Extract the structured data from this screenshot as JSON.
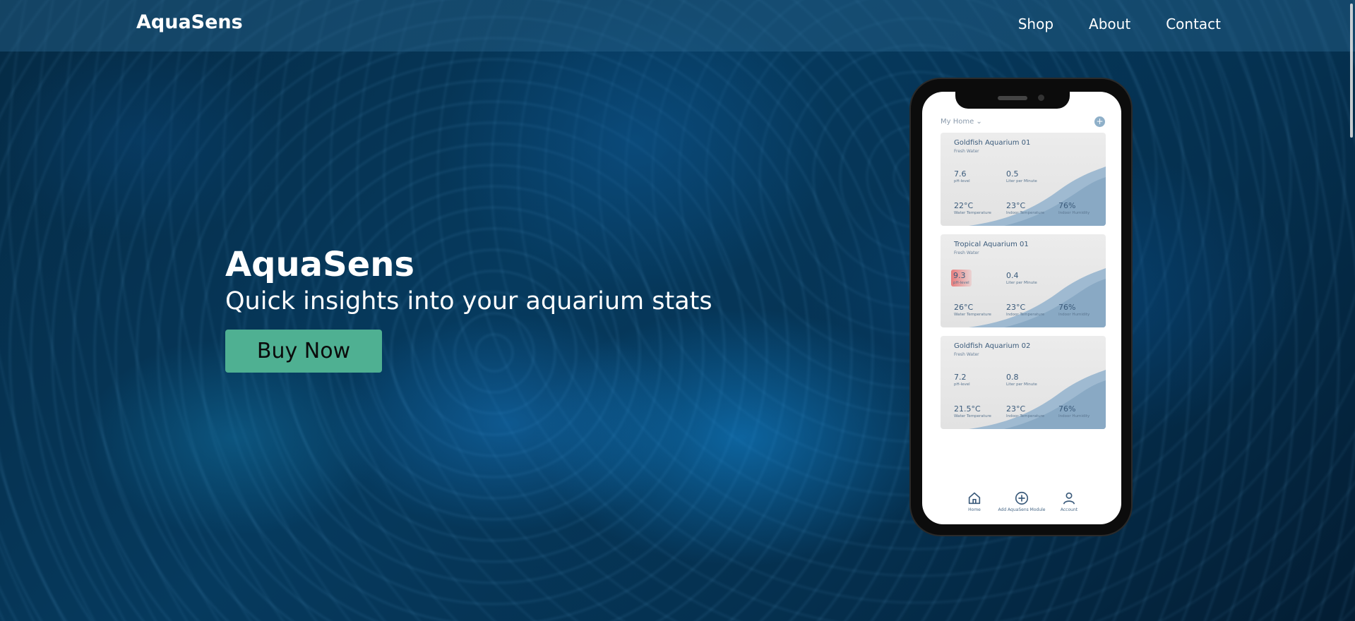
{
  "navbar": {
    "brand": "AquaSens",
    "links": [
      {
        "label": "Shop"
      },
      {
        "label": "About"
      },
      {
        "label": "Contact"
      }
    ]
  },
  "hero": {
    "title": "AquaSens",
    "subtitle": "Quick insights into your aquarium stats",
    "button_label": "Buy Now"
  },
  "phone": {
    "home_selector": "My Home ⌄",
    "add_glyph": "+",
    "cards": [
      {
        "name": "Goldfish Aquarium 01",
        "type": "Fresh Water",
        "ph": "7.6",
        "ph_label": "pH-level",
        "flow": "0.5",
        "flow_label": "Liter per Minute",
        "water_temp": "22°C",
        "water_temp_label": "Water Temperature",
        "indoor_temp": "23°C",
        "indoor_temp_label": "Indoor Temperature",
        "humidity": "76%",
        "humidity_label": "Indoor Humidity"
      },
      {
        "name": "Tropical Aquarium 01",
        "type": "Fresh Water",
        "ph": "9.3",
        "ph_label": "pH-level",
        "flow": "0.4",
        "flow_label": "Liter per Minute",
        "water_temp": "26°C",
        "water_temp_label": "Water Temperature",
        "indoor_temp": "23°C",
        "indoor_temp_label": "Indoor Temperature",
        "humidity": "76%",
        "humidity_label": "Indoor Humidity",
        "ph_alert_color": "#e65a5a"
      },
      {
        "name": "Goldfish Aquarium 02",
        "type": "Fresh Water",
        "ph": "7.2",
        "ph_label": "pH-level",
        "flow": "0.8",
        "flow_label": "Liter per Minute",
        "water_temp": "21.5°C",
        "water_temp_label": "Water Temperature",
        "indoor_temp": "23°C",
        "indoor_temp_label": "Indoor Temperature",
        "humidity": "76%",
        "humidity_label": "Indoor Humidity"
      }
    ],
    "bottom_nav": [
      {
        "label": "Home",
        "icon": "home-icon"
      },
      {
        "label": "Add AquaSens Module",
        "icon": "add-circle-icon"
      },
      {
        "label": "Account",
        "icon": "account-icon"
      }
    ]
  },
  "colors": {
    "accent_button": "#4fb092",
    "wave": "#8fb0c9",
    "background": "#04263f"
  }
}
